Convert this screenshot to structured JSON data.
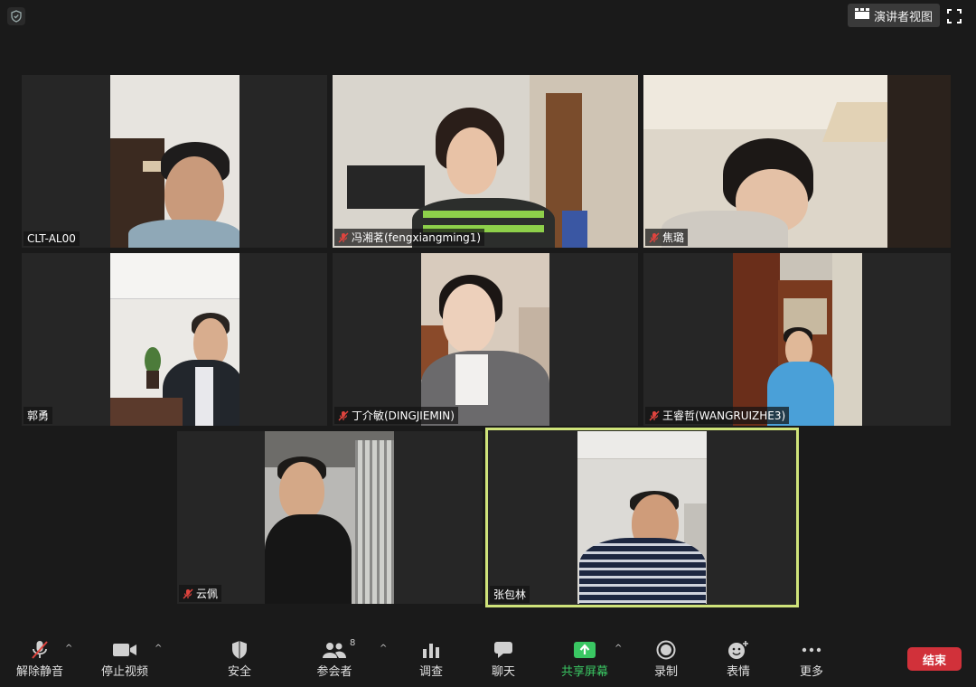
{
  "top_bar": {
    "speaker_view_label": "演讲者视图"
  },
  "participants": [
    {
      "name": "CLT-AL00",
      "muted": false
    },
    {
      "name": "冯湘茗(fengxiangming1)",
      "muted": true
    },
    {
      "name": "焦璐",
      "muted": true
    },
    {
      "name": "郭勇",
      "muted": false
    },
    {
      "name": "丁介敏(DINGJIEMIN)",
      "muted": true
    },
    {
      "name": "王睿哲(WANGRUIZHE3)",
      "muted": true
    },
    {
      "name": "云佩",
      "muted": true
    },
    {
      "name": "张包林",
      "muted": false,
      "active_speaker": true
    }
  ],
  "toolbar": {
    "unmute": "解除静音",
    "stop_video": "停止视频",
    "security": "安全",
    "participants": "参会者",
    "participants_count": "8",
    "polls": "调查",
    "chat": "聊天",
    "share_screen": "共享屏幕",
    "record": "录制",
    "reactions": "表情",
    "more": "更多",
    "end": "结束"
  },
  "colors": {
    "active_speaker_border": "#cfe37a",
    "share_green": "#3ac763",
    "end_red": "#d1313a",
    "muted_red": "#e0443e"
  }
}
